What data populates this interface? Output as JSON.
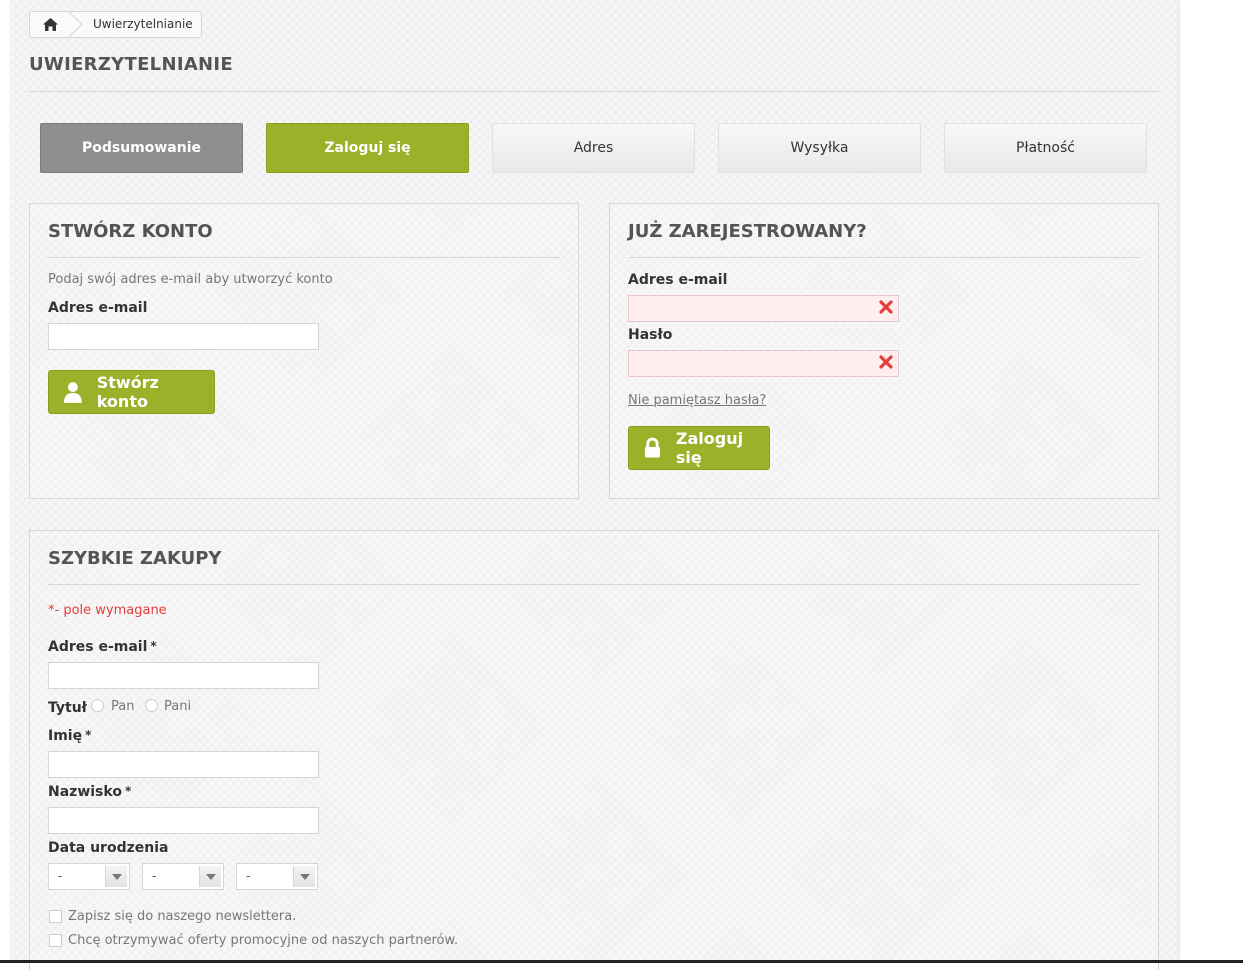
{
  "breadcrumb": {
    "home_icon": "home-icon",
    "current": "Uwierzytelnianie"
  },
  "page": {
    "title": "UWIERZYTELNIANIE"
  },
  "steps": [
    {
      "label": "Podsumowanie",
      "state": "done"
    },
    {
      "label": "Zaloguj się",
      "state": "current"
    },
    {
      "label": "Adres",
      "state": "todo"
    },
    {
      "label": "Wysyłka",
      "state": "todo"
    },
    {
      "label": "Płatność",
      "state": "todo"
    }
  ],
  "create_account": {
    "title": "STWÓRZ KONTO",
    "intro": "Podaj swój adres e-mail aby utworzyć konto",
    "email_label": "Adres e-mail",
    "email_value": "",
    "button_label": "Stwórz konto",
    "button_icon": "user-icon"
  },
  "login": {
    "title": "JUŻ ZAREJESTROWANY?",
    "email_label": "Adres e-mail",
    "email_value": "",
    "password_label": "Hasło",
    "password_value": "",
    "forgot_link": "Nie pamiętasz hasła?",
    "button_label": "Zaloguj się",
    "button_icon": "lock-icon",
    "error_icon": "error-x-icon"
  },
  "quick_buy": {
    "title": "SZYBKIE ZAKUPY",
    "required_note": "*- pole wymagane",
    "email_label": "Adres e-mail",
    "required_mark": "*",
    "title_label": "Tytuł",
    "title_options": [
      "Pan",
      "Pani"
    ],
    "first_name_label": "Imię",
    "last_name_label": "Nazwisko",
    "birth_label": "Data urodzenia",
    "birth_values": [
      "-",
      "-",
      "-"
    ],
    "newsletter_label": "Zapisz się do naszego newslettera.",
    "partners_label": "Chcę otrzymywać oferty promocyjne od naszych partnerów."
  },
  "colors": {
    "accent": "#9cb02a",
    "done": "#8f8f8f",
    "error": "#e53c3c"
  }
}
